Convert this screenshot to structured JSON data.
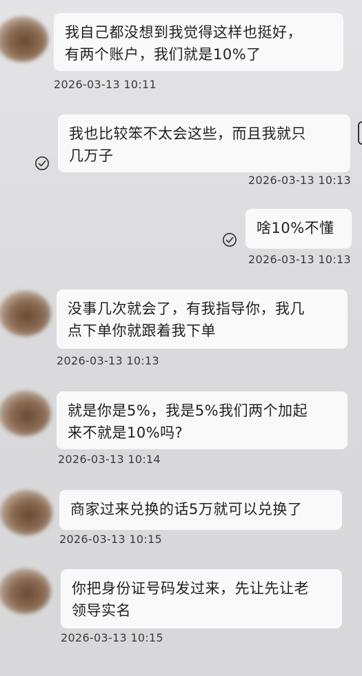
{
  "messages": [
    {
      "lines": "我自己都没想到我觉得这样也挺好，\n有两个账户，我们就是10%了",
      "time": "2026-03-13 10:11"
    },
    {
      "lines": "我也比较笨不太会这些，而且我就只\n几万子",
      "time": "2026-03-13 10:13"
    },
    {
      "lines": "啥10%不懂",
      "time": "2026-03-13 10:13"
    },
    {
      "lines": "没事几次就会了，有我指导你，我几\n点下单你就跟着我下单",
      "time": "2026-03-13 10:13"
    },
    {
      "lines": "就是你是5%，我是5%我们两个加起\n来不就是10%吗?",
      "time": "2026-03-13 10:14"
    },
    {
      "lines": "商家过来兑换的话5万就可以兑换了",
      "time": "2026-03-13 10:15"
    },
    {
      "lines": "你把身份证号码发过来，先让先让老\n领导实名",
      "time": "2026-03-13 10:15"
    }
  ],
  "icons": {
    "read_receipt": "check-circle-icon",
    "avatar": "blurred-avatar"
  }
}
